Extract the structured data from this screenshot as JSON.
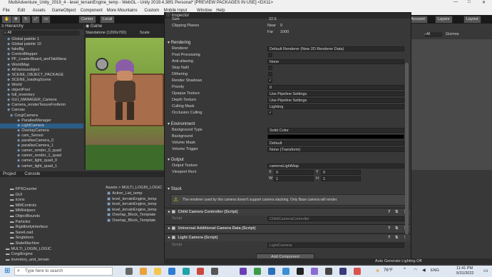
{
  "window": {
    "title": "MultiAdventure_Unity_2019_4 - level_terrainEngine_temp - WebGL - Unity 2019.4.38f1 Personal* [PREVIEW PACKAGES IN USE] <DX11>"
  },
  "menu": [
    "File",
    "Edit",
    "Assets",
    "GameObject",
    "Component",
    "More Mountains",
    "Custom",
    "Mobile Input",
    "Window",
    "Help"
  ],
  "toolbar": {
    "center": "Center",
    "local": "Local",
    "account": "Account",
    "layers": "Layers",
    "layout": "Layout"
  },
  "hierarchy": {
    "title": "Hierarchy",
    "search": "All",
    "items": [
      "Global palette 1",
      "Global palette 10",
      "fakeBg",
      "ControlMapper",
      "PF_LeaderBoard_andTabMana",
      "WorldMap",
      "AllVariousobject",
      "SCENE_OBJECT_PACKAGE",
      "SCENE_loadingScene",
      "World",
      "objectPool",
      "full_inventory",
      "GUI_MANAGER_Camera",
      "Camera_renderTexureForAnim",
      "Canvas",
      "CorgiCamera",
      "ParallaxManager",
      "LightCamera",
      "OverlayCamera",
      "cam_Sensor",
      "parallaxCamera_0",
      "parallaxCamera_1",
      "camer_render_0_quad",
      "camer_render_1_quad",
      "camer_light_quad_0",
      "camer_light_quad_1"
    ],
    "selected_index": 17
  },
  "game": {
    "tab": "Game",
    "resolution": "Standalone (1200x700)",
    "scale": "Scale"
  },
  "right": {
    "gizmos": "Gizmos",
    "all": "All"
  },
  "inspector": {
    "tab": "Inspector",
    "size_label": "Size",
    "size_value": "22.5",
    "clipping_label": "Clipping Planes",
    "near_label": "Near",
    "near_value": "0",
    "far_label": "Far",
    "far_value": "1000",
    "rendering_header": "Rendering",
    "renderer_label": "Renderer",
    "renderer_value": "Default Renderer (New 2D Renderer Data)",
    "postproc_label": "Post Processing",
    "aa_label": "Anti-aliasing",
    "aa_value": "None",
    "stopnan_label": "Stop NaN",
    "dither_label": "Dithering",
    "shadows_label": "Render Shadows",
    "priority_label": "Priority",
    "priority_value": "0",
    "opaque_label": "Opaque Texture",
    "opaque_value": "Use Pipeline Settings",
    "depth_label": "Depth Texture",
    "depth_value": "Use Pipeline Settings",
    "culling_label": "Culling Mask",
    "culling_value": "Lighting",
    "occlusion_label": "Occlusion Culling",
    "env_header": "Environment",
    "bgtype_label": "Background Type",
    "bgtype_value": "Solid Color",
    "bg_label": "Background",
    "vmask_label": "Volume Mask",
    "vmask_value": "Default",
    "vtrigger_label": "Volume Trigger",
    "vtrigger_value": "None (Transform)",
    "output_header": "Output",
    "outtex_label": "Output Texture",
    "outtex_value": "cameraLightMap",
    "viewport_label": "Viewport Rect",
    "vx": "X",
    "vx_value": "0",
    "vy": "Y",
    "vy_value": "0",
    "vw": "W",
    "vw_value": "1",
    "vh": "H",
    "vh_value": "1",
    "stack_header": "Stack",
    "stack_warning": "The renderer used by this camera doesn't support camera stacking. Only Base camera will render.",
    "comp1": "Child Camera Controller (Script)",
    "comp1_script": "ChildCameraController",
    "comp2": "Universal Additional Camera Data (Script)",
    "comp3": "Light Camera (Script)",
    "comp3_script": "LightCamera",
    "script_label": "Script",
    "add_component": "Add Component"
  },
  "project": {
    "tab1": "Project",
    "tab2": "Console",
    "breadcrumb": "Assets > MULTI_LOGIN_LOGIC",
    "folders": [
      "FPSCounter",
      "GUI",
      "Icons",
      "MMControls",
      "MMHelpers",
      "ObjectBounds",
      "Particles",
      "Rigidbodyinterface",
      "SaveLoad",
      "Singletons",
      "StateMachine",
      "MULTI_LOGIN_LOGIC",
      "CorgiEngine",
      "Inventory_and_terrain"
    ],
    "files": [
      "Action_List_temp",
      "level_terrainEngine_temp",
      "level_terrainEngine_temp",
      "level_terrainEngine_temp",
      "Overlap_Block_Template",
      "Overlap_Block_Template"
    ]
  },
  "status": {
    "text": "Auto Generate Lighting Off"
  },
  "taskbar": {
    "search": "Type here to search",
    "weather": "76°F",
    "lang": "ENG",
    "time": "11:41 PM",
    "date": "5/31/2022"
  },
  "colors": {
    "selection": "#2c5d87",
    "accent": "#4a90d9"
  }
}
